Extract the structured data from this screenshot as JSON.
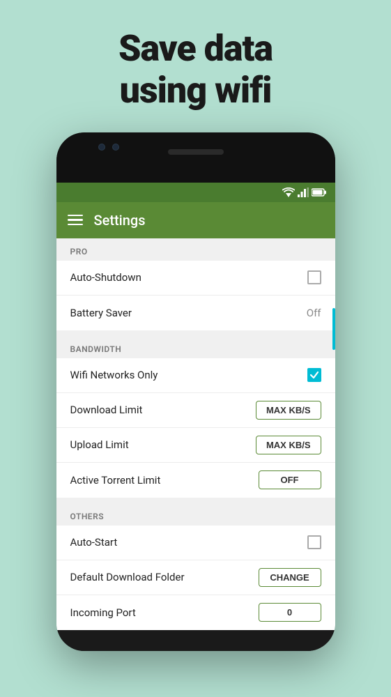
{
  "hero": {
    "title_line1": "Save data",
    "title_line2": "using wifi"
  },
  "toolbar": {
    "title": "Settings"
  },
  "sections": [
    {
      "id": "pro",
      "header": "PRO",
      "rows": [
        {
          "id": "auto-shutdown",
          "label": "Auto-Shutdown",
          "control": "checkbox",
          "checked": false
        },
        {
          "id": "battery-saver",
          "label": "Battery Saver",
          "control": "value",
          "value": "Off"
        }
      ]
    },
    {
      "id": "bandwidth",
      "header": "BANDWIDTH",
      "rows": [
        {
          "id": "wifi-networks-only",
          "label": "Wifi Networks Only",
          "control": "checkbox",
          "checked": true
        },
        {
          "id": "download-limit",
          "label": "Download Limit",
          "control": "button",
          "btnLabel": "MAX KB/S"
        },
        {
          "id": "upload-limit",
          "label": "Upload Limit",
          "control": "button",
          "btnLabel": "MAX KB/S"
        },
        {
          "id": "active-torrent-limit",
          "label": "Active Torrent Limit",
          "control": "button",
          "btnLabel": "OFF"
        }
      ]
    },
    {
      "id": "others",
      "header": "OTHERS",
      "rows": [
        {
          "id": "auto-start",
          "label": "Auto-Start",
          "control": "checkbox",
          "checked": false
        },
        {
          "id": "default-download-folder",
          "label": "Default Download Folder",
          "control": "button",
          "btnLabel": "CHANGE"
        },
        {
          "id": "incoming-port",
          "label": "Incoming Port",
          "control": "button",
          "btnLabel": "0"
        }
      ]
    }
  ],
  "icons": {
    "wifi": "▲",
    "signal": "▲",
    "battery": "▪"
  }
}
